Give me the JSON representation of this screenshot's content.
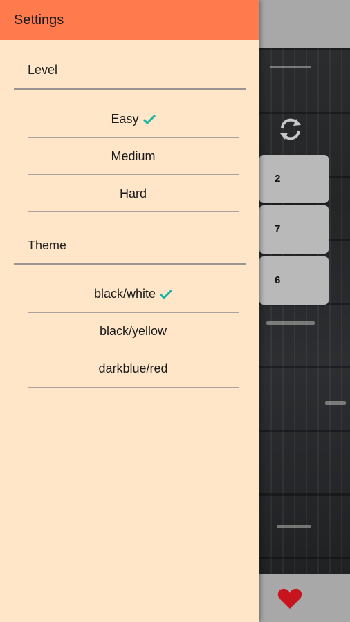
{
  "drawer": {
    "title": "Settings",
    "sections": [
      {
        "label": "Level",
        "options": [
          {
            "label": "Easy",
            "selected": true
          },
          {
            "label": "Medium",
            "selected": false
          },
          {
            "label": "Hard",
            "selected": false
          }
        ]
      },
      {
        "label": "Theme",
        "options": [
          {
            "label": "black/white",
            "selected": true
          },
          {
            "label": "black/yellow",
            "selected": false
          },
          {
            "label": "darkblue/red",
            "selected": false
          }
        ]
      }
    ],
    "colors": {
      "header": "#ff7b4e",
      "background": "#ffe6c9",
      "check": "#1ab6a6"
    }
  },
  "background_app": {
    "tiles": [
      "2",
      "7",
      "6"
    ],
    "icons": {
      "refresh": "refresh-icon",
      "favorite": "heart-icon"
    },
    "colors": {
      "heart": "#c8141e",
      "bars": "#a8a8a8"
    }
  }
}
